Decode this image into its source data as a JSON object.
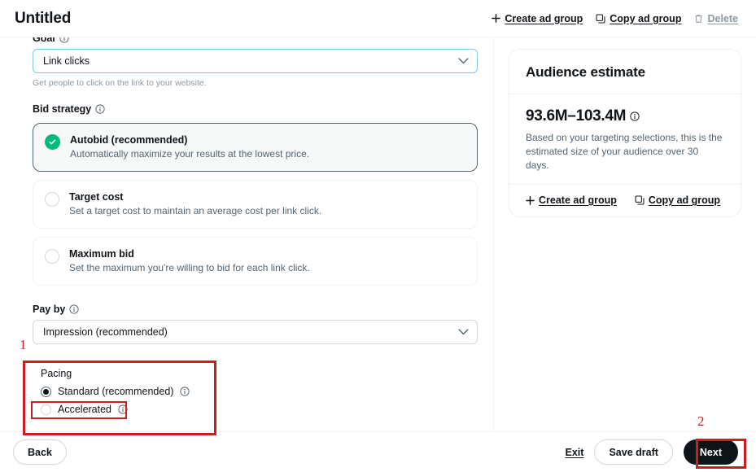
{
  "header": {
    "title": "Untitled",
    "actions": [
      {
        "label": "Create ad group",
        "icon": "plus-icon",
        "disabled": false
      },
      {
        "label": "Copy ad group",
        "icon": "copy-icon",
        "disabled": false
      },
      {
        "label": "Delete",
        "icon": "trash-icon",
        "disabled": true
      }
    ]
  },
  "form": {
    "goal": {
      "label": "Goal",
      "value": "Link clicks",
      "hint": "Get people to click on the link to your website."
    },
    "bid_strategy": {
      "label": "Bid strategy",
      "options": [
        {
          "title": "Autobid (recommended)",
          "desc": "Automatically maximize your results at the lowest price.",
          "selected": true
        },
        {
          "title": "Target cost",
          "desc": "Set a target cost to maintain an average cost per link click.",
          "selected": false
        },
        {
          "title": "Maximum bid",
          "desc": "Set the maximum you're willing to bid for each link click.",
          "selected": false
        }
      ]
    },
    "pay_by": {
      "label": "Pay by",
      "value": "Impression (recommended)"
    },
    "pacing": {
      "label": "Pacing",
      "options": [
        {
          "label": "Standard (recommended)",
          "selected": true
        },
        {
          "label": "Accelerated",
          "selected": false
        }
      ]
    }
  },
  "audience_estimate": {
    "title": "Audience estimate",
    "value": "93.6M–103.4M",
    "description": "Based on your targeting selections, this is the estimated size of your audience over 30 days.",
    "actions": [
      {
        "label": "Create ad group",
        "icon": "plus-icon"
      },
      {
        "label": "Copy ad group",
        "icon": "copy-icon"
      }
    ]
  },
  "footer": {
    "back": "Back",
    "exit": "Exit",
    "save_draft": "Save draft",
    "next": "Next"
  },
  "annotations": {
    "marker_one": "1",
    "marker_two": "2",
    "color": "#c8201f"
  }
}
